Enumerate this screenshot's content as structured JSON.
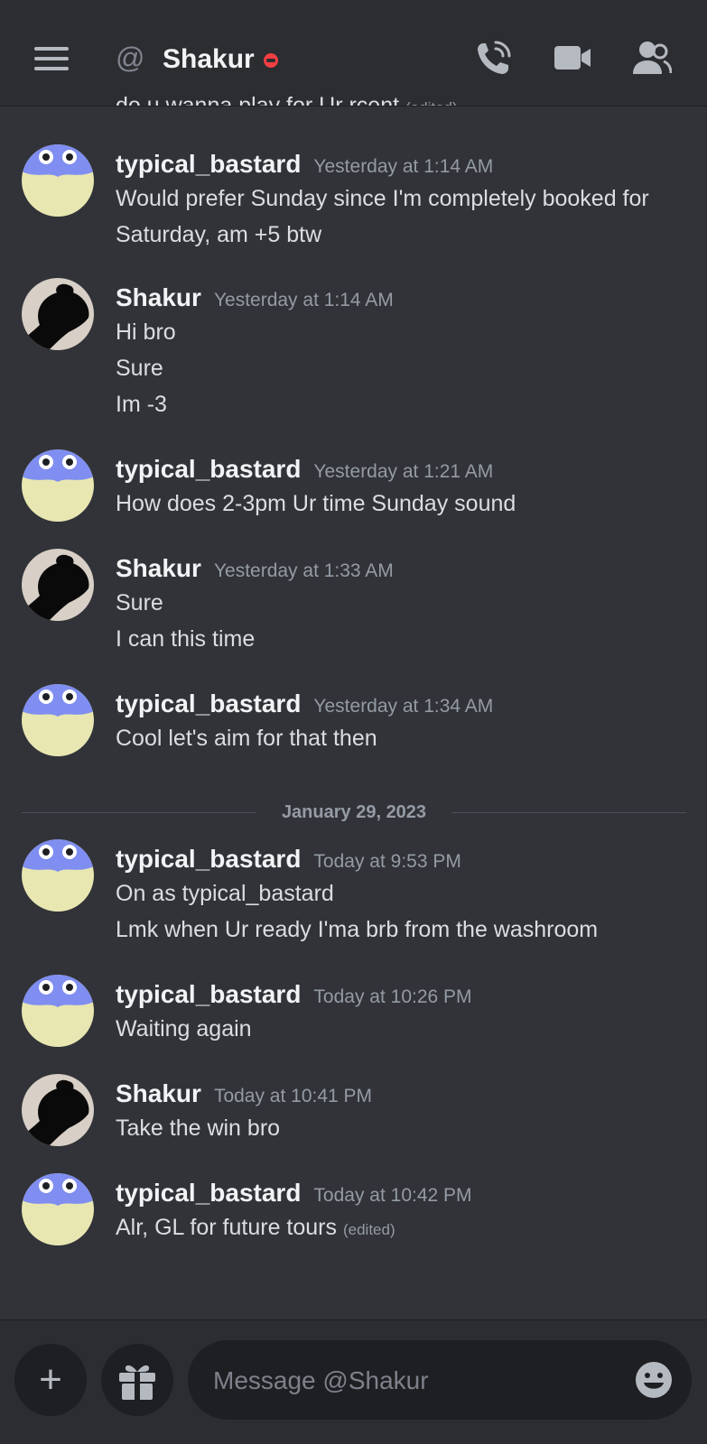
{
  "header": {
    "title": "Shakur",
    "status": "do-not-disturb",
    "icons": [
      "menu-icon",
      "at-icon",
      "voice-call-icon",
      "video-call-icon",
      "members-icon"
    ]
  },
  "partial_message": {
    "text": "do u wanna play for Ur rcent",
    "edited": "(edited)"
  },
  "messages": [
    {
      "author": "typical_bastard",
      "timestamp": "Yesterday at 1:14 AM",
      "lines": [
        "Would prefer Sunday since I'm completely booked for",
        "Saturday, am +5 btw"
      ]
    },
    {
      "author": "Shakur",
      "timestamp": "Yesterday at 1:14 AM",
      "lines": [
        "Hi bro",
        "Sure",
        "Im -3"
      ]
    },
    {
      "author": "typical_bastard",
      "timestamp": "Yesterday at 1:21 AM",
      "lines": [
        "How does 2-3pm Ur time Sunday sound"
      ]
    },
    {
      "author": "Shakur",
      "timestamp": "Yesterday at 1:33 AM",
      "lines": [
        "Sure",
        "I can this time"
      ]
    },
    {
      "author": "typical_bastard",
      "timestamp": "Yesterday at 1:34 AM",
      "lines": [
        "Cool let's aim for that then"
      ]
    },
    {
      "author": "typical_bastard",
      "timestamp": "Today at 9:53 PM",
      "lines": [
        "On as typical_bastard",
        "Lmk when Ur ready I'ma brb from the washroom"
      ]
    },
    {
      "author": "typical_bastard",
      "timestamp": "Today at 10:26 PM",
      "lines": [
        "Waiting again"
      ]
    },
    {
      "author": "Shakur",
      "timestamp": "Today at 10:41 PM",
      "lines": [
        "Take the win bro"
      ]
    },
    {
      "author": "typical_bastard",
      "timestamp": "Today at 10:42 PM",
      "lines": [
        "Alr, GL for future tours"
      ],
      "edited": "(edited)"
    }
  ],
  "date_divider": "January 29, 2023",
  "composer": {
    "placeholder": "Message @Shakur",
    "icons": [
      "plus-icon",
      "gift-icon",
      "emoji-icon"
    ]
  },
  "colors": {
    "background": "#313338",
    "header_bg": "#2b2d31",
    "dnd_status": "#f23f43",
    "avatar_blue": "#7f8ef0",
    "avatar_cream": "#e8e7b2"
  }
}
